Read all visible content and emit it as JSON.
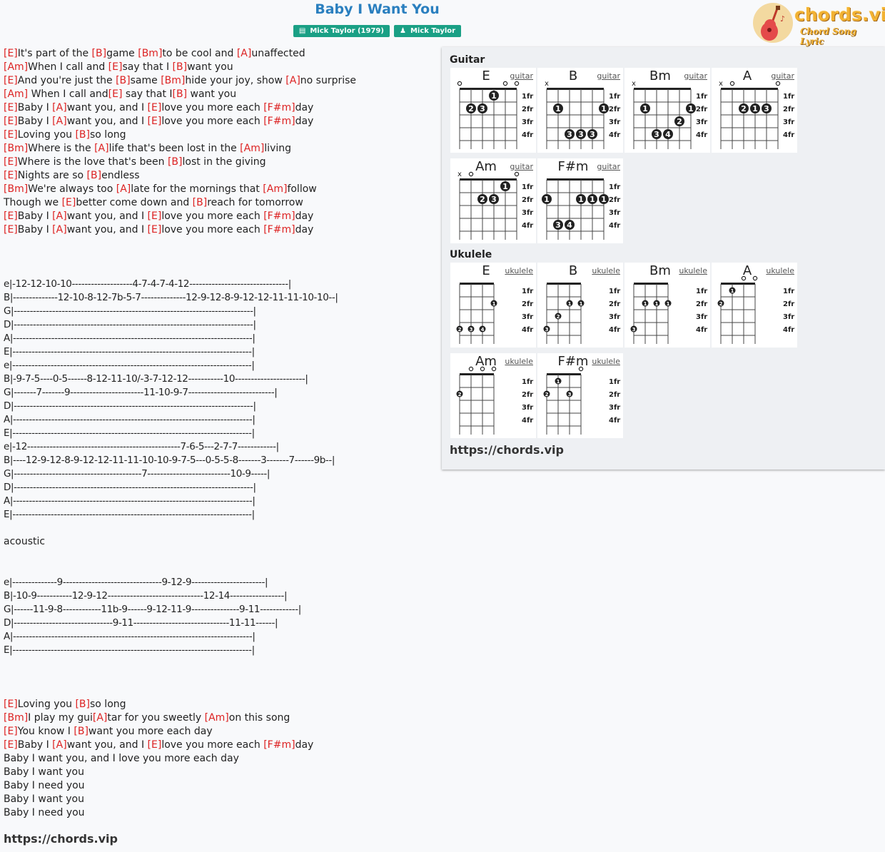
{
  "song": {
    "title": "Baby I Want You"
  },
  "badges": [
    {
      "icon": "book-icon",
      "text": "Mick Taylor (1979)"
    },
    {
      "icon": "person-icon",
      "text": "Mick Taylor"
    }
  ],
  "logo": {
    "brand": "chords.vip",
    "tagline": "Chord Song Lyric"
  },
  "lyrics": [
    [
      [
        "c",
        "E"
      ],
      [
        "t",
        "It's part of the "
      ],
      [
        "c",
        "B"
      ],
      [
        "t",
        "game "
      ],
      [
        "c",
        "Bm"
      ],
      [
        "t",
        "to be cool and "
      ],
      [
        "c",
        "A"
      ],
      [
        "t",
        "unaffected"
      ]
    ],
    [
      [
        "c",
        "Am"
      ],
      [
        "t",
        "When I call and "
      ],
      [
        "c",
        "E"
      ],
      [
        "t",
        "say that I "
      ],
      [
        "c",
        "B"
      ],
      [
        "t",
        "want you"
      ]
    ],
    [
      [
        "c",
        "E"
      ],
      [
        "t",
        "And you're just the "
      ],
      [
        "c",
        "B"
      ],
      [
        "t",
        "same "
      ],
      [
        "c",
        "Bm"
      ],
      [
        "t",
        "hide your joy, show "
      ],
      [
        "c",
        "A"
      ],
      [
        "t",
        "no surprise"
      ]
    ],
    [
      [
        "c",
        "Am"
      ],
      [
        "t",
        " When I call and"
      ],
      [
        "c",
        "E"
      ],
      [
        "t",
        " say that I"
      ],
      [
        "c",
        "B"
      ],
      [
        "t",
        " want you"
      ]
    ],
    [
      [
        "c",
        "E"
      ],
      [
        "t",
        "Baby I "
      ],
      [
        "c",
        "A"
      ],
      [
        "t",
        "want you, and I "
      ],
      [
        "c",
        "E"
      ],
      [
        "t",
        "love you more each "
      ],
      [
        "c",
        "F#m"
      ],
      [
        "t",
        "day"
      ]
    ],
    [
      [
        "c",
        "E"
      ],
      [
        "t",
        "Baby I "
      ],
      [
        "c",
        "A"
      ],
      [
        "t",
        "want you, and I "
      ],
      [
        "c",
        "E"
      ],
      [
        "t",
        "love you more each "
      ],
      [
        "c",
        "F#m"
      ],
      [
        "t",
        "day"
      ]
    ],
    [
      [
        "c",
        "E"
      ],
      [
        "t",
        "Loving you "
      ],
      [
        "c",
        "B"
      ],
      [
        "t",
        "so long"
      ]
    ],
    [
      [
        "c",
        "Bm"
      ],
      [
        "t",
        "Where is the "
      ],
      [
        "c",
        "A"
      ],
      [
        "t",
        "life that's been lost in the "
      ],
      [
        "c",
        "Am"
      ],
      [
        "t",
        "living"
      ]
    ],
    [
      [
        "c",
        "E"
      ],
      [
        "t",
        "Where is the love that's been "
      ],
      [
        "c",
        "B"
      ],
      [
        "t",
        "lost in the giving"
      ]
    ],
    [
      [
        "c",
        "E"
      ],
      [
        "t",
        "Nights are so "
      ],
      [
        "c",
        "B"
      ],
      [
        "t",
        "endless"
      ]
    ],
    [
      [
        "c",
        "Bm"
      ],
      [
        "t",
        "We're always too "
      ],
      [
        "c",
        "A"
      ],
      [
        "t",
        "late for the mornings that "
      ],
      [
        "c",
        "Am"
      ],
      [
        "t",
        "follow"
      ]
    ],
    [
      [
        "t",
        "Though we "
      ],
      [
        "c",
        "E"
      ],
      [
        "t",
        "better come down and "
      ],
      [
        "c",
        "B"
      ],
      [
        "t",
        "reach for tomorrow"
      ]
    ],
    [
      [
        "c",
        "E"
      ],
      [
        "t",
        "Baby I "
      ],
      [
        "c",
        "A"
      ],
      [
        "t",
        "want you, and I "
      ],
      [
        "c",
        "E"
      ],
      [
        "t",
        "love you more each "
      ],
      [
        "c",
        "F#m"
      ],
      [
        "t",
        "day"
      ]
    ],
    [
      [
        "c",
        "E"
      ],
      [
        "t",
        "Baby I "
      ],
      [
        "c",
        "A"
      ],
      [
        "t",
        "want you, and I "
      ],
      [
        "c",
        "E"
      ],
      [
        "t",
        "love you more each "
      ],
      [
        "c",
        "F#m"
      ],
      [
        "t",
        "day"
      ]
    ],
    [],
    [],
    [],
    [
      [
        "tab",
        "e|-12-12-10-10-------------------4-7-4-7-4-12-------------------------------|"
      ]
    ],
    [
      [
        "tab",
        "B|--------------12-10-8-12-7b-5-7--------------12-9-12-8-9-12-12-11-11-10-10--|"
      ]
    ],
    [
      [
        "tab",
        "G|---------------------------------------------------------------------------|"
      ]
    ],
    [
      [
        "tab",
        "D|---------------------------------------------------------------------------|"
      ]
    ],
    [
      [
        "tab",
        "A|---------------------------------------------------------------------------|"
      ]
    ],
    [
      [
        "tab",
        "E|---------------------------------------------------------------------------|"
      ]
    ],
    [
      [
        "tab",
        "e|---------------------------------------------------------------------------|"
      ]
    ],
    [
      [
        "tab",
        "B|-9-7-5----0-5------8-12-11-10/-3-7-12-12-----------10----------------------|"
      ]
    ],
    [
      [
        "tab",
        "G|-------7-------9-----------------------11-10-9-7---------------------------|"
      ]
    ],
    [
      [
        "tab",
        "D|---------------------------------------------------------------------------|"
      ]
    ],
    [
      [
        "tab",
        "A|---------------------------------------------------------------------------|"
      ]
    ],
    [
      [
        "tab",
        "E|---------------------------------------------------------------------------|"
      ]
    ],
    [
      [
        "tab",
        "e|-12------------------------------------------------7-6-5---2-7-7------------|"
      ]
    ],
    [
      [
        "tab",
        "B|----12-9-12-8-9-12-12-11-11-10-10-9-7-5---0-5-5-8-------3-------7------9b--|"
      ]
    ],
    [
      [
        "tab",
        "G|----------------------------------------7--------------------------10-9-----|"
      ]
    ],
    [
      [
        "tab",
        "D|---------------------------------------------------------------------------|"
      ]
    ],
    [
      [
        "tab",
        "A|---------------------------------------------------------------------------|"
      ]
    ],
    [
      [
        "tab",
        "E|---------------------------------------------------------------------------|"
      ]
    ],
    [],
    [
      [
        "t",
        "acoustic"
      ]
    ],
    [],
    [],
    [
      [
        "tab",
        "e|--------------9-------------------------------9-12-9-----------------------|"
      ]
    ],
    [
      [
        "tab",
        "B|-10-9-----------12-9-12------------------------------12-14-----------------|"
      ]
    ],
    [
      [
        "tab",
        "G|------11-9-8------------11b-9------9-12-11-9---------------9-11------------|"
      ]
    ],
    [
      [
        "tab",
        "D|-------------------------------9-11------------------------------11-11------|"
      ]
    ],
    [
      [
        "tab",
        "A|---------------------------------------------------------------------------|"
      ]
    ],
    [
      [
        "tab",
        "E|---------------------------------------------------------------------------|"
      ]
    ],
    [],
    [],
    [],
    [
      [
        "c",
        "E"
      ],
      [
        "t",
        "Loving you "
      ],
      [
        "c",
        "B"
      ],
      [
        "t",
        "so long"
      ]
    ],
    [
      [
        "c",
        "Bm"
      ],
      [
        "t",
        "I play my gui"
      ],
      [
        "c",
        "A"
      ],
      [
        "t",
        "tar for you sweetly "
      ],
      [
        "c",
        "Am"
      ],
      [
        "t",
        "on this song"
      ]
    ],
    [
      [
        "c",
        "E"
      ],
      [
        "t",
        "You know I "
      ],
      [
        "c",
        "B"
      ],
      [
        "t",
        "want you more each day"
      ]
    ],
    [
      [
        "c",
        "E"
      ],
      [
        "t",
        "Baby I "
      ],
      [
        "c",
        "A"
      ],
      [
        "t",
        "want you, and I "
      ],
      [
        "c",
        "E"
      ],
      [
        "t",
        "love you more each "
      ],
      [
        "c",
        "F#m"
      ],
      [
        "t",
        "day"
      ]
    ],
    [
      [
        "t",
        "Baby I want you, and I love you more each day"
      ]
    ],
    [
      [
        "t",
        "Baby I want you"
      ]
    ],
    [
      [
        "t",
        "Baby I need you"
      ]
    ],
    [
      [
        "t",
        "Baby I want you"
      ]
    ],
    [
      [
        "t",
        "Baby I need you"
      ]
    ]
  ],
  "footer_url": "https://chords.vip",
  "panel": {
    "guitar_heading": "Guitar",
    "ukulele_heading": "Ukulele",
    "url": "https://chords.vip",
    "fret_labels": [
      "1fr",
      "2fr",
      "3fr",
      "4fr"
    ],
    "guitar": [
      {
        "name": "E",
        "link": "guitar",
        "top": [
          "o",
          "",
          "",
          "",
          "o",
          "o"
        ],
        "dots": [
          [
            3,
            1,
            "1"
          ],
          [
            1,
            2,
            "2"
          ],
          [
            2,
            2,
            "3"
          ]
        ]
      },
      {
        "name": "B",
        "link": "guitar",
        "top": [
          "x",
          "",
          "",
          "",
          "",
          ""
        ],
        "dots": [
          [
            1,
            2,
            "1"
          ],
          [
            5,
            2,
            "1"
          ],
          [
            2,
            4,
            "3"
          ],
          [
            3,
            4,
            "3"
          ],
          [
            4,
            4,
            "3"
          ]
        ]
      },
      {
        "name": "Bm",
        "link": "guitar",
        "top": [
          "x",
          "",
          "",
          "",
          "",
          ""
        ],
        "dots": [
          [
            1,
            2,
            "1"
          ],
          [
            5,
            2,
            "1"
          ],
          [
            4,
            3,
            "2"
          ],
          [
            2,
            4,
            "3"
          ],
          [
            3,
            4,
            "4"
          ]
        ]
      },
      {
        "name": "A",
        "link": "guitar",
        "top": [
          "x",
          "o",
          "",
          "",
          "",
          "o"
        ],
        "dots": [
          [
            2,
            2,
            "2"
          ],
          [
            3,
            2,
            "1"
          ],
          [
            4,
            2,
            "3"
          ]
        ]
      },
      {
        "name": "Am",
        "link": "guitar",
        "top": [
          "x",
          "o",
          "",
          "",
          "",
          "o"
        ],
        "dots": [
          [
            4,
            1,
            "1"
          ],
          [
            2,
            2,
            "2"
          ],
          [
            3,
            2,
            "3"
          ]
        ]
      },
      {
        "name": "F#m",
        "link": "guitar",
        "top": [
          "",
          "",
          "",
          "",
          "",
          ""
        ],
        "dots": [
          [
            0,
            2,
            "1"
          ],
          [
            3,
            2,
            "1"
          ],
          [
            4,
            2,
            "1"
          ],
          [
            5,
            2,
            "1"
          ],
          [
            1,
            4,
            "3"
          ],
          [
            2,
            4,
            "4"
          ]
        ]
      }
    ],
    "ukulele": [
      {
        "name": "E",
        "link": "ukulele",
        "top": [
          "",
          "",
          "",
          ""
        ],
        "dots": [
          [
            3,
            2,
            "1"
          ],
          [
            0,
            4,
            "2"
          ],
          [
            1,
            4,
            "3"
          ],
          [
            2,
            4,
            "4"
          ]
        ]
      },
      {
        "name": "B",
        "link": "ukulele",
        "top": [
          "",
          "",
          "",
          ""
        ],
        "dots": [
          [
            2,
            2,
            "1"
          ],
          [
            3,
            2,
            "1"
          ],
          [
            1,
            3,
            "2"
          ],
          [
            0,
            4,
            "3"
          ]
        ]
      },
      {
        "name": "Bm",
        "link": "ukulele",
        "top": [
          "",
          "",
          "",
          ""
        ],
        "dots": [
          [
            1,
            2,
            "1"
          ],
          [
            2,
            2,
            "1"
          ],
          [
            3,
            2,
            "1"
          ],
          [
            0,
            4,
            "3"
          ]
        ]
      },
      {
        "name": "A",
        "link": "ukulele",
        "top": [
          "",
          "",
          "o",
          "o"
        ],
        "dots": [
          [
            1,
            1,
            "1"
          ],
          [
            0,
            2,
            "2"
          ]
        ]
      },
      {
        "name": "Am",
        "link": "ukulele",
        "top": [
          "",
          "o",
          "o",
          "o"
        ],
        "dots": [
          [
            0,
            2,
            "2"
          ]
        ]
      },
      {
        "name": "F#m",
        "link": "ukulele",
        "top": [
          "",
          "",
          "",
          "o"
        ],
        "dots": [
          [
            1,
            1,
            "1"
          ],
          [
            0,
            2,
            "2"
          ],
          [
            2,
            2,
            "3"
          ]
        ]
      }
    ]
  }
}
